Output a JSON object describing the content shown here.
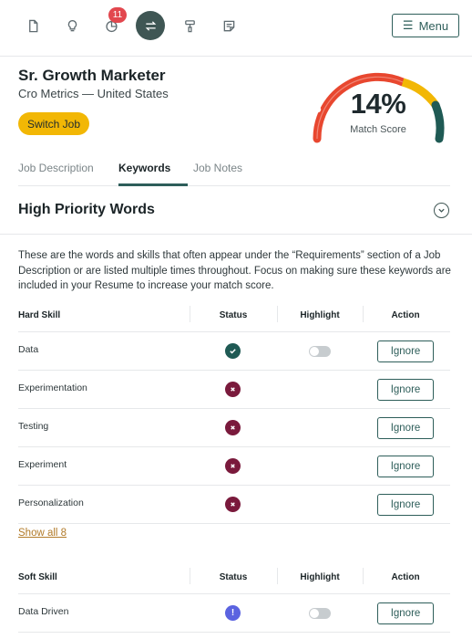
{
  "toolbar": {
    "icons": [
      "document-icon",
      "lightbulb-icon",
      "pie-chart-icon",
      "swap-icon",
      "paint-roller-icon",
      "notes-icon"
    ],
    "badge_count": "11",
    "menu_label": "Menu"
  },
  "job": {
    "title": "Sr. Growth Marketer",
    "company": "Cro Metrics — United States",
    "switch_label": "Switch Job"
  },
  "match": {
    "percent_text": "14%",
    "percent_value": 14,
    "label": "Match Score"
  },
  "tabs": [
    {
      "label": "Job Description",
      "active": false
    },
    {
      "label": "Keywords",
      "active": true
    },
    {
      "label": "Job Notes",
      "active": false
    }
  ],
  "section": {
    "title": "High Priority Words",
    "description": "These are the words and skills that often appear under the “Requirements” section of a Job Description or are listed multiple times throughout. Focus on making sure these keywords are included in your Resume to increase your match score."
  },
  "hard_skills": {
    "headers": [
      "Hard Skill",
      "Status",
      "Highlight",
      "Action"
    ],
    "rows": [
      {
        "name": "Data",
        "status": "matched",
        "highlight": false,
        "action": "Ignore"
      },
      {
        "name": "Experimentation",
        "status": "missing",
        "action": "Ignore"
      },
      {
        "name": "Testing",
        "status": "missing",
        "action": "Ignore"
      },
      {
        "name": "Experiment",
        "status": "missing",
        "action": "Ignore"
      },
      {
        "name": "Personalization",
        "status": "missing",
        "action": "Ignore"
      }
    ],
    "show_all": "Show all 8"
  },
  "soft_skills": {
    "headers": [
      "Soft Skill",
      "Status",
      "Highlight",
      "Action"
    ],
    "rows": [
      {
        "name": "Data Driven",
        "status": "warning",
        "highlight": false,
        "action": "Ignore"
      }
    ]
  },
  "colors": {
    "accent": "#2e5e5a",
    "toolbar_active": "#3f5654",
    "badge": "#e2474e",
    "switch_button": "#f2b705",
    "status_matched": "#1f5a54",
    "status_missing": "#7a1a3c",
    "status_warning": "#5b63e0",
    "gauge_red": "#e8472f",
    "gauge_yellow": "#f2b705",
    "gauge_green": "#1f5a54",
    "link": "#b27b2a"
  }
}
